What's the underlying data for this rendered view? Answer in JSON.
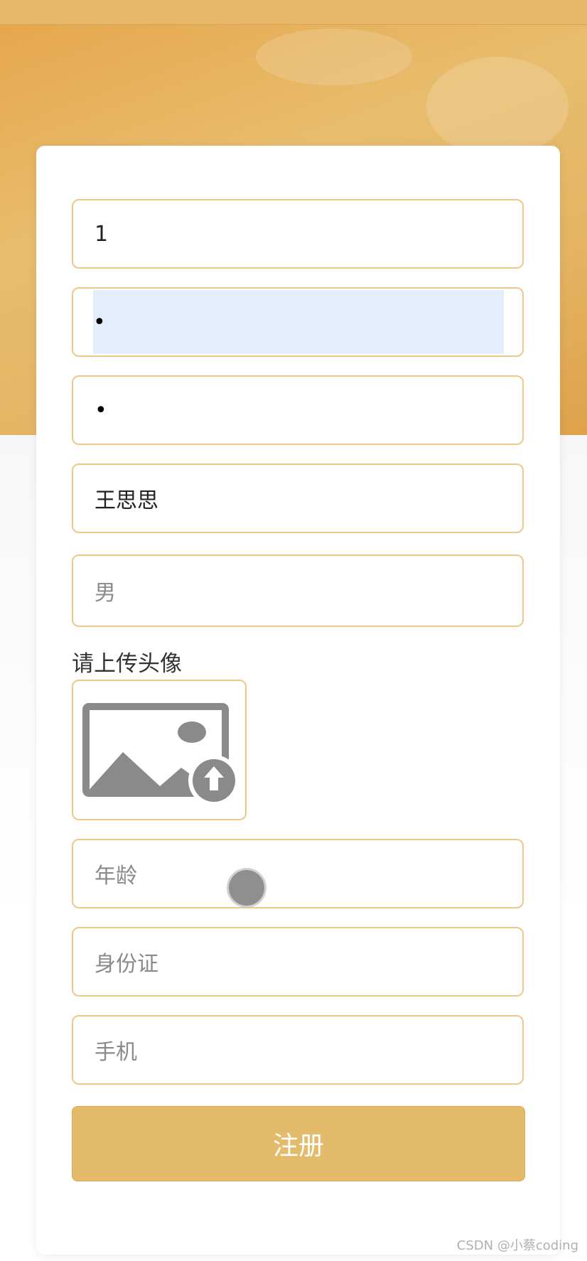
{
  "form": {
    "username_value": "1",
    "password_value": "•",
    "confirm_password_value": "•",
    "name_value": "王思思",
    "gender_placeholder": "男",
    "upload_label": "请上传头像",
    "age_placeholder": "年龄",
    "id_card_placeholder": "身份证",
    "phone_placeholder": "手机",
    "submit_label": "注册"
  },
  "watermark": "CSDN @小蔡coding",
  "colors": {
    "accent": "#e4bb6a",
    "border": "#ecc989",
    "background_top": "#e6a54a"
  },
  "icons": {
    "upload": "image-upload-icon"
  }
}
